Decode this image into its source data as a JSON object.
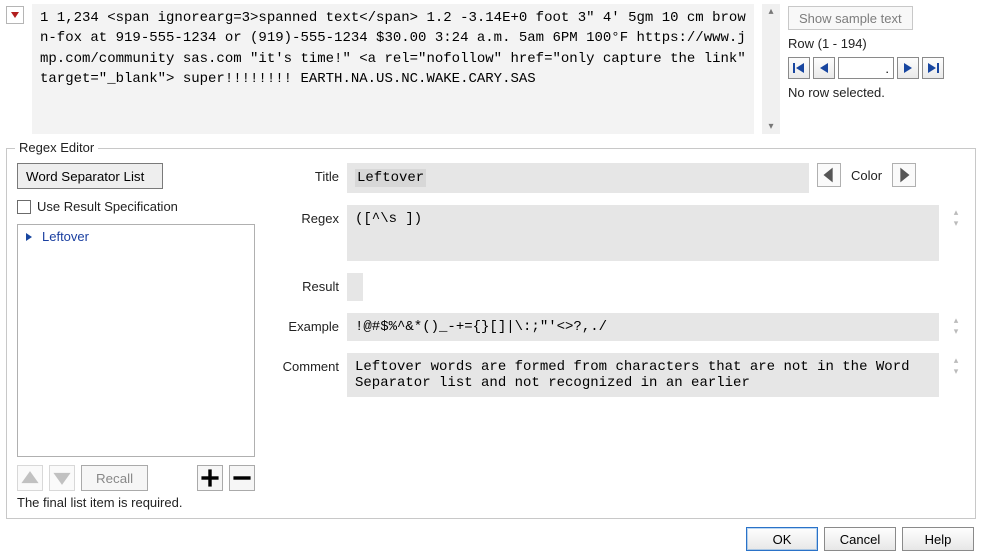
{
  "sample_text": "1 1,234 <span ignorearg=3>spanned text</span> 1.2 -3.14E+0 foot 3\" 4' 5gm 10 cm brown-fox at 919-555-1234 or (919)-555-1234 $30.00 3:24 a.m. 5am 6PM 100°F  https://www.jmp.com/community sas.com  \"it's time!\" <a rel=\"nofollow\" href=\"only capture the link\" target=\"_blank\"> super!!!!!!!! EARTH.NA.US.NC.WAKE.CARY.SAS",
  "right": {
    "show_sample": "Show sample text",
    "row_label": "Row (1 - 194)",
    "nav_value": ".",
    "status": "No row selected."
  },
  "editor": {
    "legend": "Regex Editor",
    "word_sep_button": "Word Separator List",
    "use_result_label": "Use Result Specification",
    "list": {
      "items": [
        {
          "label": "Leftover"
        }
      ]
    },
    "recall": "Recall",
    "note": "The final list item is required.",
    "labels": {
      "title": "Title",
      "regex": "Regex",
      "result": "Result",
      "example": "Example",
      "comment": "Comment",
      "color": "Color"
    },
    "fields": {
      "title": "Leftover",
      "regex": "([^\\s ])",
      "result": "",
      "example": "!@#$%^&*()_-+={}[]|\\:;\"'<>?,./",
      "comment": "Leftover words are formed from characters that are not in the Word Separator list and not recognized in an earlier"
    }
  },
  "footer": {
    "ok": "OK",
    "cancel": "Cancel",
    "help": "Help"
  }
}
